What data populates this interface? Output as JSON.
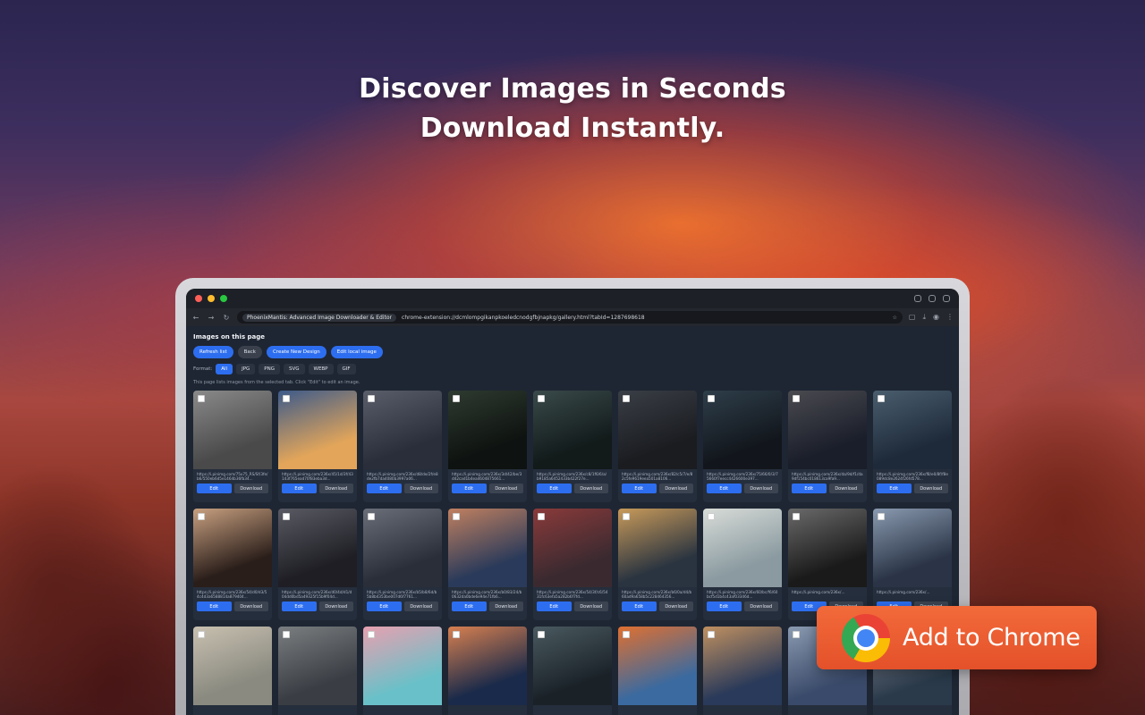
{
  "headline": {
    "line1": "Discover Images in Seconds",
    "line2": "Download Instantly."
  },
  "browser": {
    "tab_chip": "PhoenixMantis: Advanced Image Downloader & Editor",
    "url": "chrome-extension://dcmlompgikanpkoeledcnodgfbjnapkg/gallery.html?tabId=1287698618"
  },
  "gallery": {
    "title": "Images on this page",
    "actions": [
      {
        "label": "Refresh list",
        "style": "primary"
      },
      {
        "label": "Back",
        "style": "dark"
      },
      {
        "label": "Create New Design",
        "style": "primary"
      },
      {
        "label": "Edit local image",
        "style": "primary"
      }
    ],
    "format_label": "Format:",
    "formats": [
      {
        "label": "All",
        "active": true
      },
      {
        "label": "JPG",
        "active": false
      },
      {
        "label": "PNG",
        "active": false
      },
      {
        "label": "SVG",
        "active": false
      },
      {
        "label": "WEBP",
        "active": false
      },
      {
        "label": "GIF",
        "active": false
      }
    ],
    "hint": "This page lists images from the selected tab. Click \"Edit\" to edit an image.",
    "edit_label": "Edit",
    "download_label": "Download",
    "cards": [
      {
        "url": "https://i.pinimg.com/75x75_RS/Sf/3fe/b6/550eb6d5e1464b36fb34...",
        "colors": [
          "#4a4a4a",
          "#8a8a8a"
        ]
      },
      {
        "url": "https://i.pinimg.com/236x/45/1d/3f/43143f765ead70f83eba3d...",
        "colors": [
          "#e2a55a",
          "#3c5a8a"
        ]
      },
      {
        "url": "https://i.pinimg.com/236x/d8/de/2f/e8de2fb7da4080b3997a06...",
        "colors": [
          "#2a2e3a",
          "#5a5e6a"
        ]
      },
      {
        "url": "https://i.pinimg.com/236x/3d/42/be/3d42cad1b4ea4604875661...",
        "colors": [
          "#0e1210",
          "#2e3a30"
        ]
      },
      {
        "url": "https://i.pinimg.com/236x/c8/1f6/6/a/b9185a6452433b422f27e...",
        "colors": [
          "#121a1a",
          "#3a4a4a"
        ]
      },
      {
        "url": "https://i.pinimg.com/236x/82/c5/7/e/82c5fe9619eea501a8106...",
        "colors": [
          "#1a1c20",
          "#3a3e46"
        ]
      },
      {
        "url": "https://i.pinimg.com/236x/75/66/0/3/75660f7eecc4426600e397...",
        "colors": [
          "#12161c",
          "#2e3e4a"
        ]
      },
      {
        "url": "https://i.pinimg.com/236x/da/9d/f1/da9df154bc018613ca9fa9...",
        "colors": [
          "#1a1e2a",
          "#4a4a50"
        ]
      },
      {
        "url": "https://i.pinimg.com/236x/f8/e0/8f/f8e089dc8e2624f26fd578...",
        "colors": [
          "#1e2a3a",
          "#4a5e6e"
        ]
      },
      {
        "url": "https://i.pinimg.com/236x/54/d0/d3/54c4d3a6588814a879404...",
        "colors": [
          "#2a1e1a",
          "#c8a080"
        ]
      },
      {
        "url": "https://i.pinimg.com/236x/d0/4d/d1/d04dd0bd5a49325f15b9f04d...",
        "colors": [
          "#1e1e24",
          "#5a5a64"
        ]
      },
      {
        "url": "https://i.pinimg.com/236x/b5/b8/6d/b5b8b4353be007d6f7761...",
        "colors": [
          "#2a2e38",
          "#6a6e78"
        ]
      },
      {
        "url": "https://i.pinimg.com/236x/b0/83/24/b0632da0bde6e94e71fb6...",
        "colors": [
          "#2a3a5a",
          "#c08060"
        ]
      },
      {
        "url": "https://i.pinimg.com/236x/54/3f/c6/5431fc63efa5a282b6f7fd...",
        "colors": [
          "#3a2a30",
          "#8a3a3a"
        ]
      },
      {
        "url": "https://i.pinimg.com/236x/b6/0a/d4/b60ad9a658b5c228464356...",
        "colors": [
          "#2a3440",
          "#c89a5a"
        ]
      },
      {
        "url": "https://i.pinimg.com/236x/60/bc/f6/60bcf5d1b4c43af03346d...",
        "colors": [
          "#8a9aa0",
          "#d8dcd8"
        ]
      },
      {
        "url": "https://i.pinimg.com/236x/...",
        "colors": [
          "#1a1a1a",
          "#6a6a6a"
        ]
      },
      {
        "url": "https://i.pinimg.com/236x/...",
        "colors": [
          "#2a3446",
          "#8a9ab0"
        ]
      },
      {
        "url": "",
        "colors": [
          "#8a8a80",
          "#c8c0b0"
        ]
      },
      {
        "url": "",
        "colors": [
          "#3a3e44",
          "#7a7e80"
        ]
      },
      {
        "url": "",
        "colors": [
          "#6ac0c8",
          "#e8a0b0"
        ]
      },
      {
        "url": "",
        "colors": [
          "#1a2a4a",
          "#d88050"
        ]
      },
      {
        "url": "",
        "colors": [
          "#1a2228",
          "#4a5a60"
        ]
      },
      {
        "url": "",
        "colors": [
          "#3a6aa0",
          "#e07030"
        ]
      },
      {
        "url": "",
        "colors": [
          "#2a3a5a",
          "#c09060"
        ]
      },
      {
        "url": "",
        "colors": [
          "#3a4a6a",
          "#8a9ab0"
        ]
      },
      {
        "url": "",
        "colors": [
          "#2a3a4a",
          "#8a8a9a"
        ]
      }
    ]
  },
  "cta": {
    "label": "Add to Chrome"
  },
  "colors": {
    "accent": "#2d6ef0",
    "cta": "#e95b30",
    "panel": "#1e2633"
  }
}
